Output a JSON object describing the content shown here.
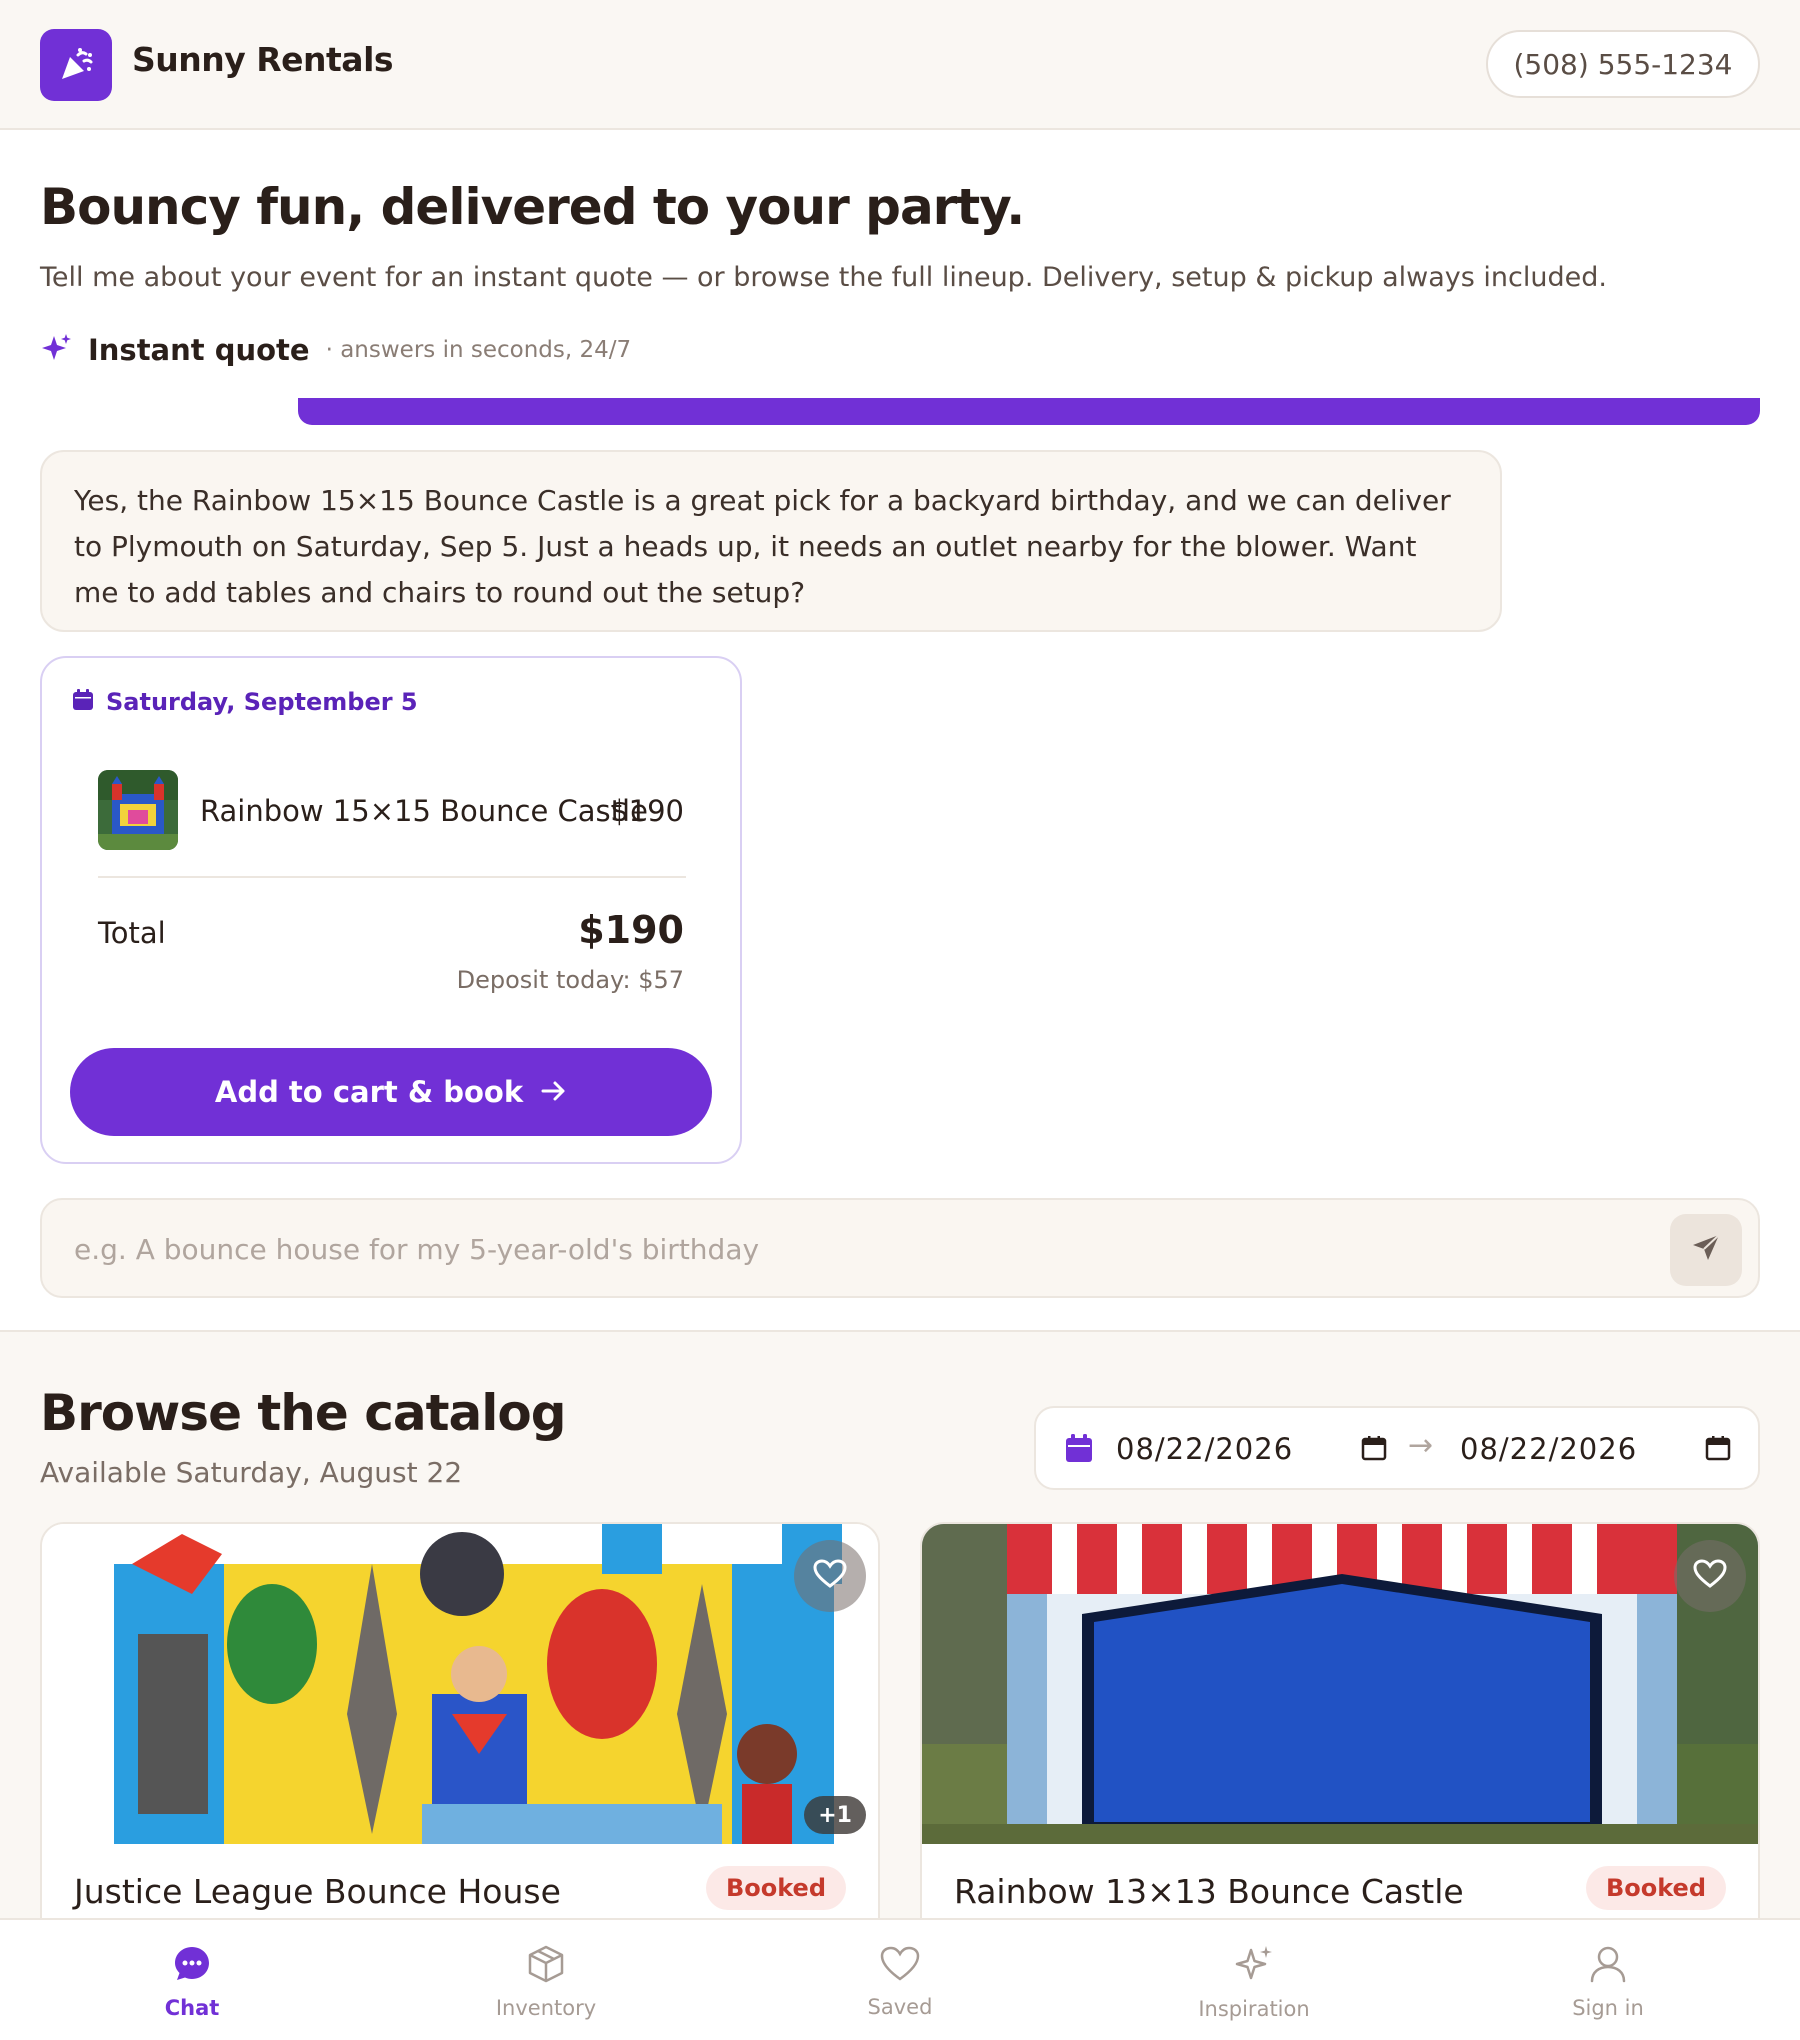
{
  "header": {
    "brand": "Sunny Rentals",
    "phone": "(508) 555-1234"
  },
  "hero": {
    "title": "Bouncy fun, delivered to your party.",
    "subtitle": "Tell me about your event for an instant quote — or browse the full lineup. Delivery, setup & pickup always included.",
    "instant_quote_label": "Instant quote",
    "instant_quote_meta": "· answers in seconds, 24/7"
  },
  "chat": {
    "assistant_message": "Yes, the Rainbow 15×15 Bounce Castle is a great pick for a backyard birthday, and we can deliver to Plymouth on Saturday, Sep 5. Just a heads up, it needs an outlet nearby for the blower. Want me to add tables and chairs to round out the setup?",
    "input_placeholder": "e.g. A bounce house for my 5-year-old's birthday",
    "input_value": ""
  },
  "quote": {
    "date_label": "Saturday, September 5",
    "item_name": "Rainbow 15×15 Bounce Castle",
    "item_price": "$190",
    "total_label": "Total",
    "total_value": "$190",
    "deposit": "Deposit today: $57",
    "cta_label": "Add to cart & book"
  },
  "catalog": {
    "title": "Browse the catalog",
    "subtitle": "Available Saturday, August 22",
    "date_from": "08/22/2026",
    "date_to": "08/22/2026",
    "items": [
      {
        "name": "Justice League Bounce House",
        "status": "Booked",
        "extra_photos": "+1"
      },
      {
        "name": "Rainbow 13×13 Bounce Castle",
        "status": "Booked"
      }
    ]
  },
  "nav": {
    "items": [
      {
        "label": "Chat",
        "icon": "chat-icon",
        "active": true
      },
      {
        "label": "Inventory",
        "icon": "box-icon"
      },
      {
        "label": "Saved",
        "icon": "heart-icon"
      },
      {
        "label": "Inspiration",
        "icon": "sparkle-icon"
      },
      {
        "label": "Sign in",
        "icon": "user-icon"
      }
    ]
  },
  "colors": {
    "accent": "#7130d6",
    "booked_text": "#c53a2c",
    "booked_bg": "#fce9e7",
    "page_bg": "#faf7f3"
  }
}
